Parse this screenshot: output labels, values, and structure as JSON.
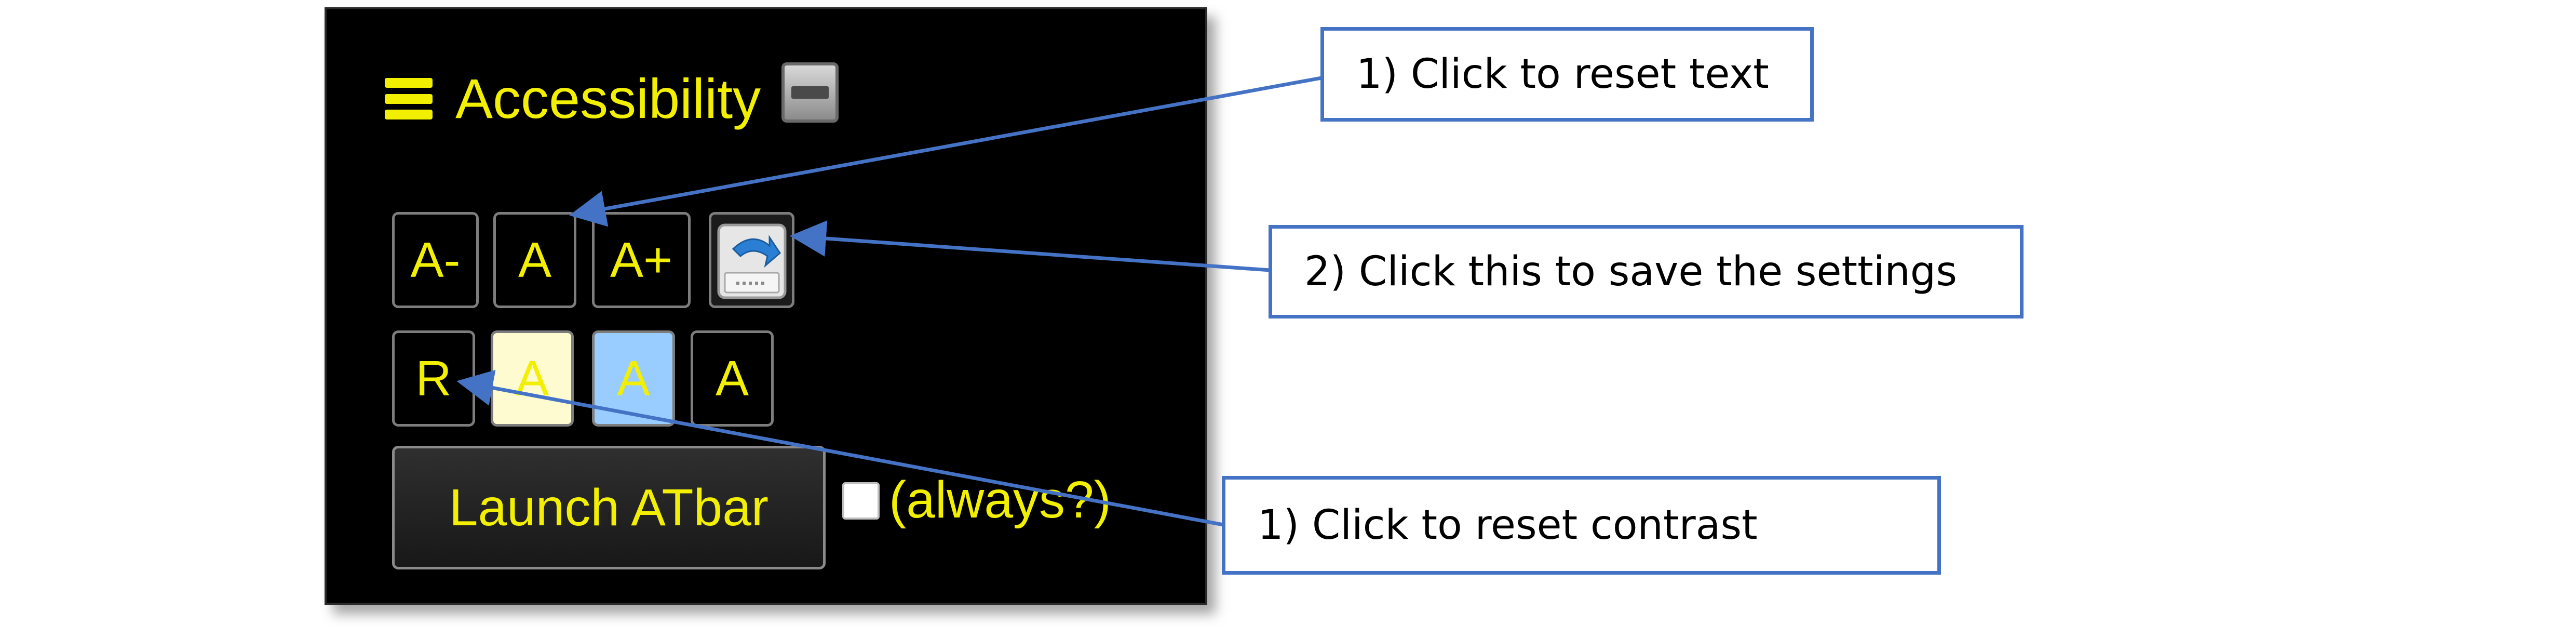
{
  "widget": {
    "title": "Accessibility",
    "menu_icon": "hamburger-icon",
    "minimize_icon": "minimize-icon",
    "text_size_buttons": [
      "A-",
      "A",
      "A+"
    ],
    "save_icon": "save-settings-icon",
    "contrast_buttons": [
      "R",
      "A",
      "A",
      "A"
    ],
    "launch_label": "Launch ATbar",
    "always_label": "(always?)",
    "always_checked": false
  },
  "callouts": {
    "reset_text": "1) Click to reset text",
    "save_settings": "2) Click this to save the settings",
    "reset_contrast": "1) Click to reset contrast"
  },
  "colors": {
    "accent_yellow": "#f2ef00",
    "panel_background": "#000000",
    "contrast_cream": "#fffbd0",
    "contrast_blue": "#99ccff",
    "callout_border": "#4472c4"
  }
}
